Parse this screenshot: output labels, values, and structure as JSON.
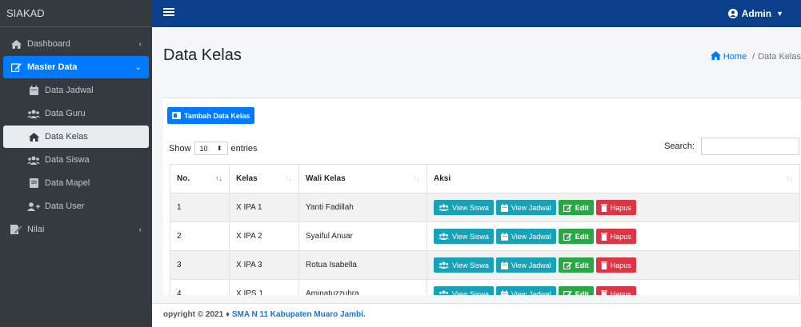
{
  "sidebar": {
    "brand": "SIAKAD",
    "items": [
      {
        "label": "Dashboard",
        "icon": "home-icon"
      },
      {
        "label": "Master Data",
        "icon": "edit-icon"
      },
      {
        "label": "Data Jadwal",
        "icon": "calendar-icon"
      },
      {
        "label": "Data Guru",
        "icon": "users-icon"
      },
      {
        "label": "Data Kelas",
        "icon": "home-icon"
      },
      {
        "label": "Data Siswa",
        "icon": "users-icon"
      },
      {
        "label": "Data Mapel",
        "icon": "book-icon"
      },
      {
        "label": "Data User",
        "icon": "user-plus-icon"
      },
      {
        "label": "Nilai",
        "icon": "file-signature-icon"
      }
    ]
  },
  "topbar": {
    "user": "Admin"
  },
  "page": {
    "title": "Data Kelas",
    "breadcrumb_home": "Home",
    "breadcrumb_separator": "/",
    "breadcrumb_current": "Data Kelas"
  },
  "card": {
    "add_button": "Tambah Data Kelas",
    "show_label": "Show",
    "entries_value": "10",
    "entries_label": "entries",
    "search_label": "Search:",
    "search_value": ""
  },
  "table": {
    "headers": {
      "no": "No.",
      "kelas": "Kelas",
      "wali": "Wali Kelas",
      "aksi": "Aksi"
    },
    "rows": [
      {
        "no": "1",
        "kelas": "X IPA 1",
        "wali": "Yanti Fadillah"
      },
      {
        "no": "2",
        "kelas": "X IPA 2",
        "wali": "Syaiful Anuar"
      },
      {
        "no": "3",
        "kelas": "X IPA 3",
        "wali": "Rotua Isabella"
      },
      {
        "no": "4",
        "kelas": "X IPS 1",
        "wali": "Aminatuzzuhra"
      }
    ],
    "actions": {
      "view_siswa": "View Siswa",
      "view_jadwal": "View Jadwal",
      "edit": "Edit",
      "hapus": "Hapus"
    }
  },
  "footer": {
    "copyright": "opyright © 2021 ♦ ",
    "school": "SMA N 11 Kabupaten Muaro Jambi."
  },
  "colors": {
    "sidebar": "#343a40",
    "topbar": "#0b3f8c",
    "primary": "#007bff",
    "info": "#17a2b8",
    "success": "#28a745",
    "danger": "#dc3545"
  }
}
